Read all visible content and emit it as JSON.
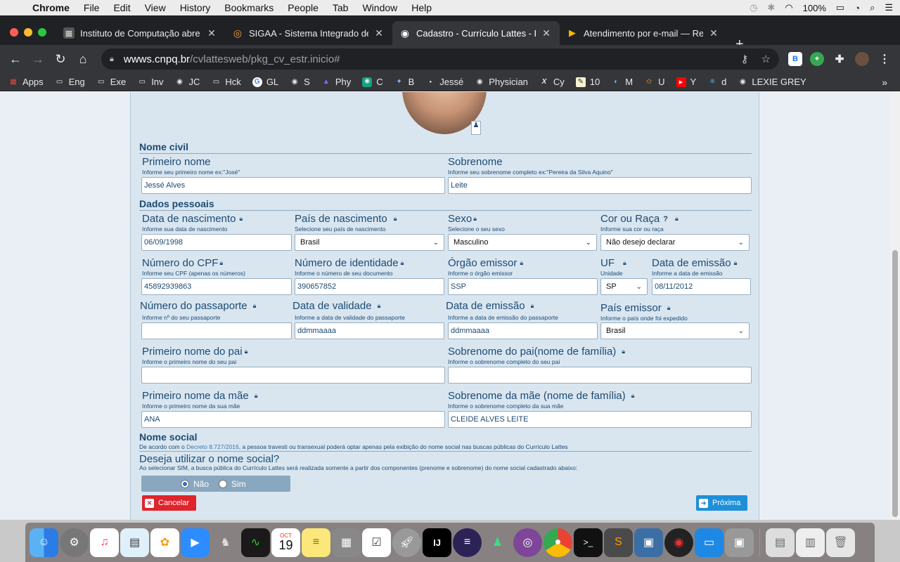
{
  "menubar": {
    "app": "Chrome",
    "items": [
      "File",
      "Edit",
      "View",
      "History",
      "Bookmarks",
      "People",
      "Tab",
      "Window",
      "Help"
    ],
    "battery": "100%"
  },
  "tabs": [
    {
      "title": "Instituto de Computação abre",
      "favicon": "ic-favicon"
    },
    {
      "title": "SIGAA - Sistema Integrado de",
      "favicon": "sigaa-favicon"
    },
    {
      "title": "Cadastro - Currículo Lattes - F",
      "favicon": "globe-favicon",
      "active": true
    },
    {
      "title": "Atendimento por e-mail — Rec",
      "favicon": "drive-favicon"
    }
  ],
  "address": {
    "host": "wwws.cnpq.br",
    "path": "/cvlattesweb/pkg_cv_estr.inicio#"
  },
  "bookmarks": [
    {
      "label": "Apps",
      "icon": "apps-grid-icon"
    },
    {
      "label": "Eng",
      "icon": "folder-icon"
    },
    {
      "label": "Exe",
      "icon": "folder-icon"
    },
    {
      "label": "Inv",
      "icon": "folder-icon"
    },
    {
      "label": "JC",
      "icon": "globe-icon"
    },
    {
      "label": "Hck",
      "icon": "folder-icon"
    },
    {
      "label": "GL",
      "icon": "google-icon"
    },
    {
      "label": "S",
      "icon": "globe-icon"
    },
    {
      "label": "Phy",
      "icon": "book-icon"
    },
    {
      "label": "C",
      "icon": "openai-icon"
    },
    {
      "label": "B",
      "icon": "spark-icon"
    },
    {
      "label": "Jessé",
      "icon": "dot-icon"
    },
    {
      "label": "Physician",
      "icon": "globe-icon"
    },
    {
      "label": "Cy",
      "icon": "x-icon"
    },
    {
      "label": "10",
      "icon": "note-icon"
    },
    {
      "label": "M",
      "icon": "wave-icon"
    },
    {
      "label": "U",
      "icon": "star-icon"
    },
    {
      "label": "Y",
      "icon": "youtube-icon"
    },
    {
      "label": "d",
      "icon": "react-icon"
    },
    {
      "label": "LEXIE GREY",
      "icon": "globe-icon"
    }
  ],
  "form": {
    "sections": {
      "nome_civil": "Nome civil",
      "dados_pessoais": "Dados pessoais",
      "nome_social": "Nome social"
    },
    "primeiro_nome": {
      "label": "Primeiro nome",
      "hint": "Informe seu primeiro nome ex:\"José\"",
      "value": "Jessé Alves"
    },
    "sobrenome": {
      "label": "Sobrenome",
      "hint": "Informe seu sobrenome completo ex:\"Pereira da Silva Aquino\"",
      "value": "Leite"
    },
    "data_nascimento": {
      "label": "Data de nascimento",
      "hint": "Informe sua data de nascimento",
      "value": "06/09/1998"
    },
    "pais_nascimento": {
      "label": "País de nascimento",
      "hint": "Selecione seu país de nascimento",
      "value": "Brasil"
    },
    "sexo": {
      "label": "Sexo",
      "hint": "Selecione o seu sexo",
      "value": "Masculino"
    },
    "cor_raca": {
      "label": "Cor ou Raça",
      "hint": "Informe sua cor ou raça",
      "value": "Não desejo declarar",
      "help": "?"
    },
    "cpf": {
      "label": "Número do CPF",
      "hint": "Informe seu CPF (apenas os números)",
      "value": "45892939863"
    },
    "identidade": {
      "label": "Número de identidade",
      "hint": "Informe o número de seu documento",
      "value": "390657852"
    },
    "orgao_emissor": {
      "label": "Órgão emissor",
      "hint": "Informe o órgão emissor",
      "value": "SSP"
    },
    "uf": {
      "label": "UF",
      "hint": "Unidade",
      "value": "SP"
    },
    "data_emissao": {
      "label": "Data de emissão",
      "hint": "Informe a data de emissão",
      "value": "08/11/2012"
    },
    "passaporte": {
      "label": "Número do passaporte",
      "hint": "Informe nº do seu passaporte",
      "value": ""
    },
    "data_validade": {
      "label": "Data de validade",
      "hint": "Informe a data de validade do passaporte",
      "value": "ddmmaaaa"
    },
    "data_emissao_passaporte": {
      "label": "Data de emissão",
      "hint": "Informe a data de emissão do passaporte",
      "value": "ddmmaaaa"
    },
    "pais_emissor": {
      "label": "País emissor",
      "hint": "Informe o país onde foi expedido",
      "value": "Brasil"
    },
    "primeiro_nome_pai": {
      "label": "Primeiro nome do pai",
      "hint": "Informe o primeiro nome do seu pai",
      "value": ""
    },
    "sobrenome_pai": {
      "label": "Sobrenome do pai(nome de família)",
      "hint": "Informe o sobrenome completo do seu pai",
      "value": ""
    },
    "primeiro_nome_mae": {
      "label": "Primeiro nome da mãe",
      "hint": "Informe o primeiro nome da sua mãe",
      "value": "ANA"
    },
    "sobrenome_mae": {
      "label": "Sobrenome da mãe (nome de família)",
      "hint": "Informe o sobrenome completo da sua mãe",
      "value": "CLEIDE ALVES LEITE"
    },
    "nome_social_note_pre": "De acordo com o ",
    "nome_social_link": "Decreto 8.727/2016",
    "nome_social_note_post": ", a pessoa travesti ou transexual poderá optar apenas pela exibição do nome social nas buscas públicas do Currículo Lattes",
    "deseja_label": "Deseja utilizar o nome social?",
    "deseja_hint": "Ao selecionar SIM, a busca pública do Currículo Lattes será realizada somente a partir dos componentes (prenome e sobrenome) do nome social cadastrado abaixo:",
    "radio_nao": "Não",
    "radio_sim": "Sim",
    "radio_selected": "Não",
    "cancel_label": "Cancelar",
    "next_label": "Próxima"
  },
  "dock_apps": [
    "finder-icon",
    "system-preferences-icon",
    "music-icon",
    "preview-icon",
    "photos-icon",
    "zoom-icon",
    "chess-icon",
    "activity-monitor-icon",
    "calendar-icon",
    "notes-icon",
    "calculator-icon",
    "reminders-icon",
    "launchpad-icon",
    "intellij-icon",
    "eclipse-icon",
    "android-studio-icon",
    "tor-icon",
    "chrome-icon",
    "terminal-icon",
    "sublime-icon",
    "virtualbox-icon",
    "davinci-icon",
    "remote-desktop-icon",
    "image-capture-icon",
    "documents-icon",
    "downloads-icon",
    "trash-icon"
  ],
  "calendar": {
    "month": "OCT",
    "day": "19"
  },
  "colors": {
    "panel_bg": "#d9e6f0",
    "label": "#1d4a73",
    "cancel": "#e0242b",
    "next": "#1f8fd8"
  }
}
